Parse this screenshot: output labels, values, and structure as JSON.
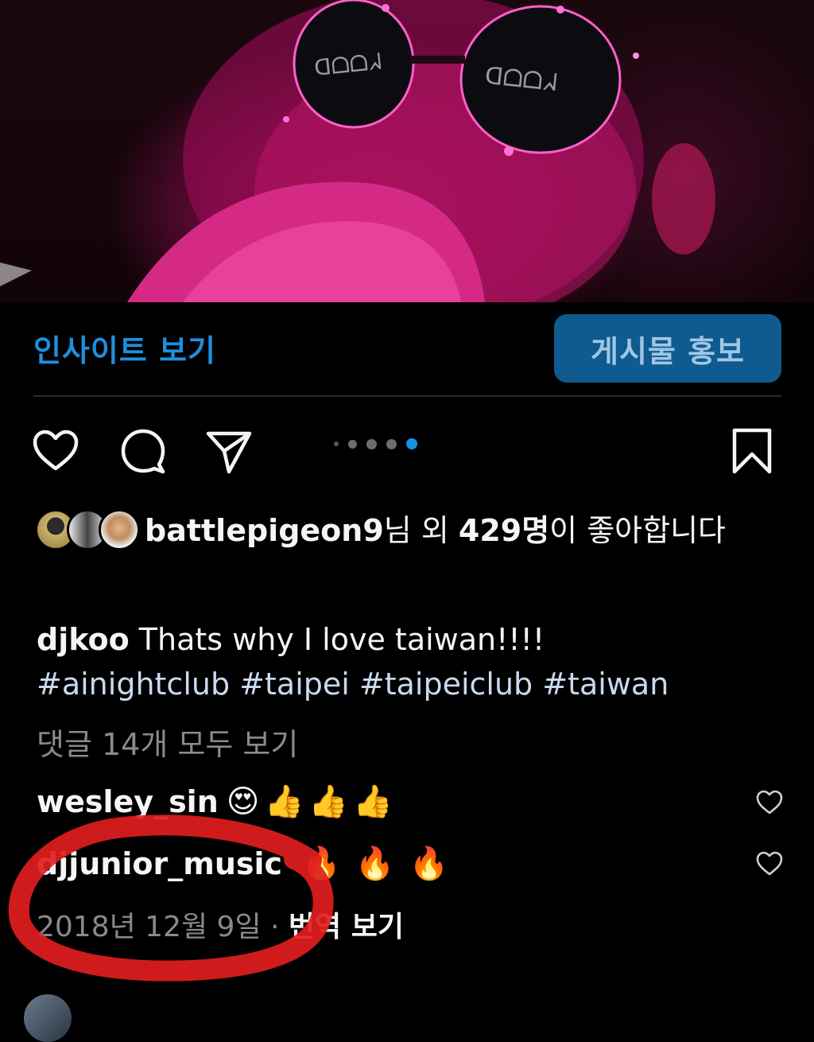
{
  "insights": {
    "view_insights_label": "인사이트 보기",
    "promote_label": "게시물 홍보"
  },
  "actions": {
    "like_icon": "heart-icon",
    "comment_icon": "comment-icon",
    "share_icon": "send-icon",
    "save_icon": "bookmark-icon",
    "carousel_total": 5,
    "carousel_active": 5
  },
  "likes": {
    "first_user": "battlepigeon9",
    "middle": "님 외 ",
    "count": "429명",
    "suffix": "이 좋아합니다"
  },
  "caption": {
    "user": "djkoo",
    "text": "Thats why I love taiwan!!!!",
    "hashtags": "#ainightclub #taipei #taipeiclub #taiwan"
  },
  "view_all_comments": "댓글 14개 모두 보기",
  "comments": [
    {
      "user": "wesley_sin",
      "text": "😍👍👍👍"
    },
    {
      "user": "djjunior_music",
      "text": "🔥🔥🔥"
    }
  ],
  "post_date": {
    "date": "2018년 12월 9일",
    "separator": " · ",
    "translate": "번역 보기"
  },
  "colors": {
    "link_blue": "#1d8fe0",
    "promote_bg": "#0f5a8f",
    "carousel_active": "#1d8fe0",
    "annotation_red": "#e11d1d"
  }
}
